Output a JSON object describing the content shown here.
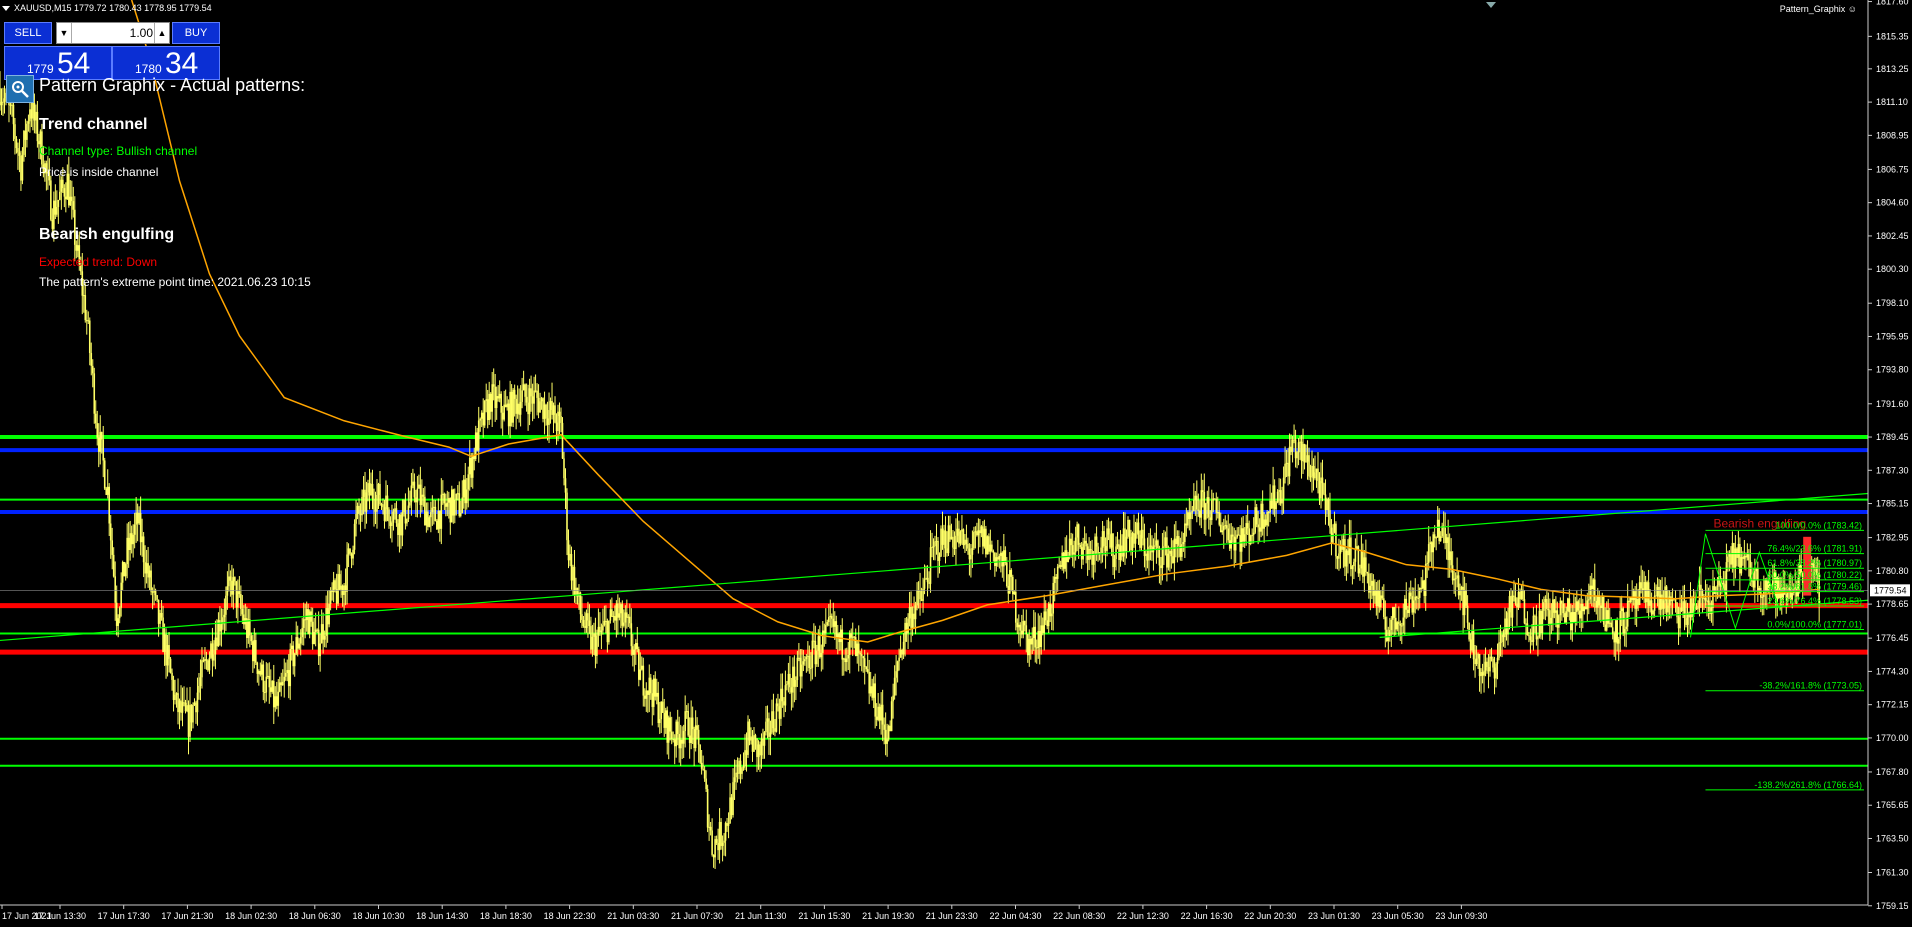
{
  "header": {
    "symbol": "XAUUSD,M15",
    "ohlc": "1779.72 1780.43 1778.95 1779.54",
    "indicator_name": "Pattern_Graphix"
  },
  "trade_panel": {
    "sell_label": "SELL",
    "buy_label": "BUY",
    "lot_value": "1.00",
    "sell_price_small": "1779",
    "sell_price_big": "54",
    "buy_price_small": "1780",
    "buy_price_big": "34"
  },
  "info": {
    "title": "Pattern Graphix - Actual patterns:",
    "channel_heading": "Trend channel",
    "channel_type": "Channel type: Bullish channel",
    "channel_status": "Price is inside channel",
    "engulf_heading": "Bearish engulfing",
    "expected_trend": "Expected trend: Down",
    "extreme_time": "The pattern's extreme point time: 2021.06.23 10:15"
  },
  "pattern_label": "Bearish engulfing",
  "colors": {
    "background": "#000000",
    "candle": "#ffff66",
    "ma": "#ffa500",
    "level_green": "#00ff00",
    "level_blue": "#0022ff",
    "level_red": "#ff0000",
    "text_green": "#00ff00",
    "text_red": "#ff0000"
  },
  "chart_data": {
    "type": "candlestick",
    "ylim": [
      1759.2,
      1817.7
    ],
    "y_ticks": [
      "1817.60",
      "1815.35",
      "1813.25",
      "1811.10",
      "1808.95",
      "1806.75",
      "1804.60",
      "1802.45",
      "1800.30",
      "1798.10",
      "1795.95",
      "1793.80",
      "1791.60",
      "1789.45",
      "1787.30",
      "1785.15",
      "1782.95",
      "1780.80",
      "1778.65",
      "1776.45",
      "1774.30",
      "1772.15",
      "1770.00",
      "1767.80",
      "1765.65",
      "1763.50",
      "1761.30",
      "1759.15"
    ],
    "current_price": "1779.54",
    "x_ticks": [
      "17 Jun 2021",
      "17 Jun 13:30",
      "17 Jun 17:30",
      "17 Jun 21:30",
      "18 Jun 02:30",
      "18 Jun 06:30",
      "18 Jun 10:30",
      "18 Jun 14:30",
      "18 Jun 18:30",
      "18 Jun 22:30",
      "21 Jun 03:30",
      "21 Jun 07:30",
      "21 Jun 11:30",
      "21 Jun 15:30",
      "21 Jun 19:30",
      "21 Jun 23:30",
      "22 Jun 04:30",
      "22 Jun 08:30",
      "22 Jun 12:30",
      "22 Jun 16:30",
      "22 Jun 20:30",
      "23 Jun 01:30",
      "23 Jun 05:30",
      "23 Jun 09:30"
    ],
    "anchors": [
      [
        0,
        1812
      ],
      [
        8,
        1810
      ],
      [
        14,
        1807
      ],
      [
        20,
        1811
      ],
      [
        28,
        1808
      ],
      [
        35,
        1804
      ],
      [
        45,
        1806
      ],
      [
        52,
        1801
      ],
      [
        58,
        1797
      ],
      [
        65,
        1790
      ],
      [
        72,
        1786
      ],
      [
        78,
        1778
      ],
      [
        85,
        1782
      ],
      [
        92,
        1784
      ],
      [
        100,
        1780
      ],
      [
        110,
        1776
      ],
      [
        118,
        1772
      ],
      [
        126,
        1771
      ],
      [
        135,
        1774
      ],
      [
        145,
        1777
      ],
      [
        155,
        1780
      ],
      [
        165,
        1777
      ],
      [
        175,
        1774
      ],
      [
        185,
        1772
      ],
      [
        195,
        1775
      ],
      [
        205,
        1778
      ],
      [
        212,
        1776
      ],
      [
        222,
        1779
      ],
      [
        230,
        1780
      ],
      [
        238,
        1784
      ],
      [
        248,
        1786
      ],
      [
        258,
        1785
      ],
      [
        268,
        1784
      ],
      [
        278,
        1786
      ],
      [
        288,
        1784
      ],
      [
        298,
        1785
      ],
      [
        308,
        1785
      ],
      [
        318,
        1789
      ],
      [
        328,
        1792
      ],
      [
        338,
        1791
      ],
      [
        348,
        1792
      ],
      [
        358,
        1792
      ],
      [
        368,
        1791
      ],
      [
        375,
        1790
      ],
      [
        380,
        1782
      ],
      [
        388,
        1778
      ],
      [
        396,
        1776
      ],
      [
        404,
        1777
      ],
      [
        412,
        1778
      ],
      [
        420,
        1777
      ],
      [
        428,
        1774
      ],
      [
        436,
        1773
      ],
      [
        444,
        1771
      ],
      [
        452,
        1770
      ],
      [
        460,
        1771
      ],
      [
        468,
        1769
      ],
      [
        476,
        1763
      ],
      [
        484,
        1764
      ],
      [
        492,
        1767
      ],
      [
        500,
        1770
      ],
      [
        508,
        1769
      ],
      [
        516,
        1771
      ],
      [
        524,
        1773
      ],
      [
        532,
        1774
      ],
      [
        540,
        1775
      ],
      [
        548,
        1776
      ],
      [
        556,
        1777
      ],
      [
        562,
        1776
      ],
      [
        570,
        1776
      ],
      [
        578,
        1774
      ],
      [
        586,
        1772
      ],
      [
        594,
        1770
      ],
      [
        600,
        1775
      ],
      [
        608,
        1778
      ],
      [
        616,
        1779
      ],
      [
        624,
        1782
      ],
      [
        632,
        1783
      ],
      [
        640,
        1783
      ],
      [
        648,
        1782
      ],
      [
        656,
        1783
      ],
      [
        664,
        1782
      ],
      [
        672,
        1781
      ],
      [
        680,
        1778
      ],
      [
        688,
        1776
      ],
      [
        696,
        1777
      ],
      [
        704,
        1779
      ],
      [
        712,
        1782
      ],
      [
        720,
        1783
      ],
      [
        728,
        1782
      ],
      [
        736,
        1783
      ],
      [
        744,
        1782
      ],
      [
        752,
        1783
      ],
      [
        760,
        1783
      ],
      [
        768,
        1782
      ],
      [
        776,
        1782
      ],
      [
        784,
        1782
      ],
      [
        792,
        1783
      ],
      [
        800,
        1785
      ],
      [
        808,
        1785
      ],
      [
        816,
        1784
      ],
      [
        824,
        1783
      ],
      [
        832,
        1783
      ],
      [
        840,
        1784
      ],
      [
        848,
        1785
      ],
      [
        856,
        1786
      ],
      [
        864,
        1789
      ],
      [
        872,
        1788
      ],
      [
        880,
        1787
      ],
      [
        888,
        1784
      ],
      [
        896,
        1782
      ],
      [
        904,
        1782
      ],
      [
        912,
        1781
      ],
      [
        920,
        1779
      ],
      [
        928,
        1777
      ],
      [
        936,
        1778
      ],
      [
        944,
        1779
      ],
      [
        952,
        1780
      ],
      [
        960,
        1784
      ],
      [
        968,
        1782
      ],
      [
        976,
        1780
      ],
      [
        984,
        1776
      ],
      [
        992,
        1774
      ],
      [
        1000,
        1775
      ],
      [
        1008,
        1778
      ],
      [
        1016,
        1779
      ],
      [
        1024,
        1777
      ],
      [
        1032,
        1778
      ],
      [
        1040,
        1778
      ],
      [
        1048,
        1778
      ],
      [
        1056,
        1778
      ],
      [
        1064,
        1780
      ],
      [
        1072,
        1778
      ],
      [
        1080,
        1777
      ],
      [
        1088,
        1778
      ],
      [
        1096,
        1779
      ],
      [
        1104,
        1779
      ],
      [
        1112,
        1779
      ],
      [
        1120,
        1778
      ],
      [
        1128,
        1778
      ],
      [
        1136,
        1779
      ],
      [
        1144,
        1779
      ],
      [
        1152,
        1780
      ],
      [
        1160,
        1782
      ],
      [
        1168,
        1781
      ],
      [
        1176,
        1780
      ],
      [
        1184,
        1780
      ],
      [
        1192,
        1779
      ],
      [
        1200,
        1780
      ],
      [
        1208,
        1781
      ],
      [
        1216,
        1779.5
      ]
    ],
    "moving_average": [
      [
        88,
        1817.7
      ],
      [
        100,
        1814
      ],
      [
        120,
        1806
      ],
      [
        140,
        1800
      ],
      [
        160,
        1796
      ],
      [
        190,
        1792
      ],
      [
        230,
        1790.5
      ],
      [
        270,
        1789.5
      ],
      [
        300,
        1788.8
      ],
      [
        315,
        1788.2
      ],
      [
        340,
        1789
      ],
      [
        375,
        1789.6
      ],
      [
        400,
        1787
      ],
      [
        430,
        1784
      ],
      [
        460,
        1781.5
      ],
      [
        490,
        1779
      ],
      [
        520,
        1777.5
      ],
      [
        550,
        1776.6
      ],
      [
        580,
        1776.2
      ],
      [
        600,
        1776.8
      ],
      [
        630,
        1777.6
      ],
      [
        660,
        1778.6
      ],
      [
        700,
        1779.2
      ],
      [
        740,
        1779.9
      ],
      [
        780,
        1780.6
      ],
      [
        820,
        1781.1
      ],
      [
        860,
        1781.8
      ],
      [
        890,
        1782.6
      ],
      [
        910,
        1782.1
      ],
      [
        940,
        1781.2
      ],
      [
        970,
        1780.9
      ],
      [
        1000,
        1780.3
      ],
      [
        1030,
        1779.6
      ],
      [
        1060,
        1779.2
      ],
      [
        1090,
        1779.1
      ],
      [
        1120,
        1779.0
      ],
      [
        1150,
        1779.2
      ],
      [
        1180,
        1779.3
      ],
      [
        1216,
        1779.6
      ]
    ],
    "horizontal_levels": [
      {
        "price": 1789.45,
        "color": "green",
        "width": 4
      },
      {
        "price": 1788.6,
        "color": "blue",
        "width": 4
      },
      {
        "price": 1785.4,
        "color": "green",
        "width": 2
      },
      {
        "price": 1784.6,
        "color": "blue",
        "width": 4
      },
      {
        "price": 1778.55,
        "color": "red",
        "width": 5
      },
      {
        "price": 1776.75,
        "color": "green",
        "width": 2
      },
      {
        "price": 1775.55,
        "color": "red",
        "width": 5
      },
      {
        "price": 1769.95,
        "color": "green",
        "width": 2
      },
      {
        "price": 1768.2,
        "color": "green",
        "width": 2
      }
    ],
    "channel_lines": [
      {
        "from": [
          0,
          1776.3
        ],
        "to": [
          1530,
          1785.8
        ],
        "color": "#00ff00"
      },
      {
        "from": [
          1130,
          1776.5
        ],
        "to": [
          1530,
          1778.9
        ],
        "color": "#00ff00"
      }
    ],
    "fibonacci": [
      {
        "label": "100.0/0.0% (1783.42)",
        "price": 1783.42
      },
      {
        "label": "76.4%/23.6% (1781.91)",
        "price": 1781.91
      },
      {
        "label": "61.8%/38.2% (1780.97)",
        "price": 1780.97
      },
      {
        "label": "50.0%/50.0% (1780.22)",
        "price": 1780.22
      },
      {
        "label": "38.2%/61.8% (1779.46)",
        "price": 1779.46
      },
      {
        "label": "23.6%/76.4% (1778.53)",
        "price": 1778.53
      },
      {
        "label": "0.0%/100.0% (1777.01)",
        "price": 1777.01
      },
      {
        "label": "-38.2%/161.8% (1773.05)",
        "price": 1773.05
      },
      {
        "label": "-138.2%/261.8% (1766.64)",
        "price": 1766.64
      }
    ]
  }
}
